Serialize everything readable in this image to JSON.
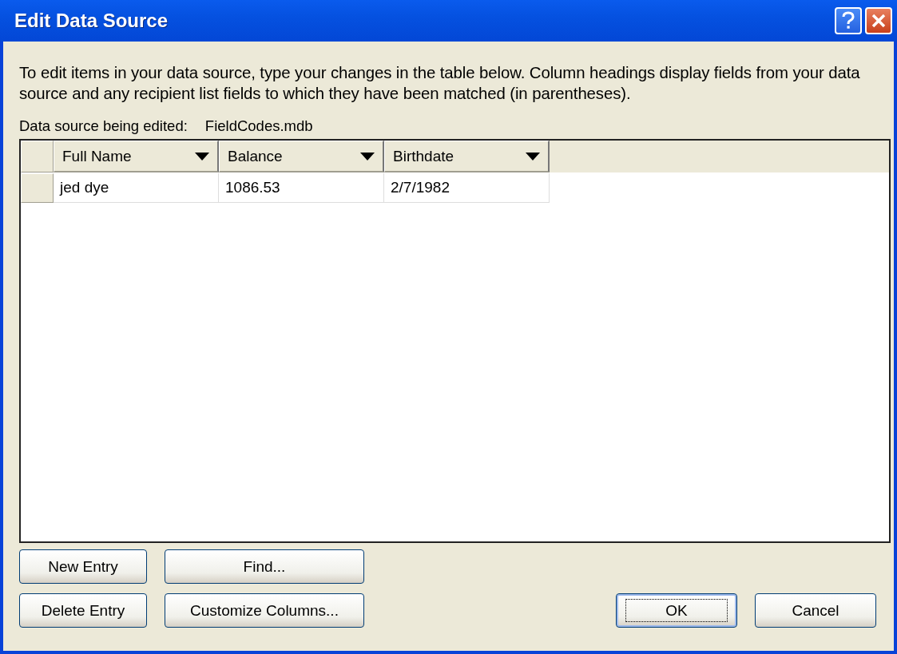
{
  "window": {
    "title": "Edit Data Source"
  },
  "instructions": "To edit items in your data source, type your changes in the table below. Column headings display fields from your data source and any recipient list fields to which they have been matched (in parentheses).",
  "source": {
    "label": "Data source being edited:",
    "value": "FieldCodes.mdb"
  },
  "table": {
    "columns": [
      "Full Name",
      "Balance",
      "Birthdate"
    ],
    "rows": [
      [
        "jed dye",
        "1086.53",
        "2/7/1982"
      ]
    ]
  },
  "buttons": [
    {
      "label": "New Entry",
      "kind": "side"
    },
    {
      "label": "Find...",
      "kind": "side"
    },
    {
      "label": "Delete Entry",
      "kind": "side"
    },
    {
      "label": "Customize Columns...",
      "kind": "side"
    },
    {
      "label": "OK",
      "kind": "default"
    },
    {
      "label": "Cancel",
      "kind": "plain"
    }
  ]
}
